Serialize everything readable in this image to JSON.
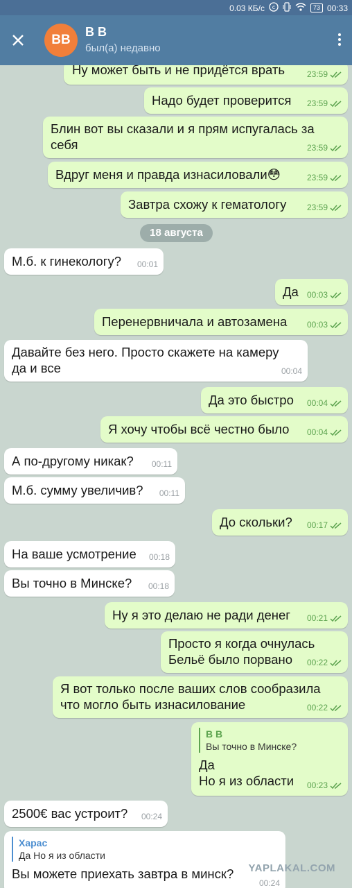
{
  "status_bar": {
    "speed": "0.03 КБ/с",
    "battery": "73",
    "time": "00:33"
  },
  "header": {
    "avatar_initials": "BB",
    "title": "В В",
    "status": "был(а) недавно"
  },
  "date_separator": "18 августа",
  "messages": [
    {
      "text": "Ну может быть и не придётся врать",
      "time": "23:59"
    },
    {
      "text": "Надо будет проверится",
      "time": "23:59"
    },
    {
      "text": "Блин вот вы сказали и я прям испугалась за\nсебя",
      "time": "23:59"
    },
    {
      "text": "Вдруг меня и правда изнасиловали😳",
      "time": "23:59"
    },
    {
      "text": "Завтра схожу к гематологу",
      "time": "23:59"
    },
    {
      "text": "М.б. к гинекологу?",
      "time": "00:01"
    },
    {
      "text": "Да",
      "time": "00:03"
    },
    {
      "text": "Перенервничала и автозамена",
      "time": "00:03"
    },
    {
      "text": "Давайте без него. Просто скажете на камеру\nда и все",
      "time": "00:04"
    },
    {
      "text": "Да это быстро",
      "time": "00:04"
    },
    {
      "text": "Я хочу чтобы всё честно было",
      "time": "00:04"
    },
    {
      "text": "А по-другому никак?",
      "time": "00:11"
    },
    {
      "text": "М.б. сумму увеличив?",
      "time": "00:11"
    },
    {
      "text": "До скольки?",
      "time": "00:17"
    },
    {
      "text": "На ваше усмотрение",
      "time": "00:18"
    },
    {
      "text": "Вы точно в Минске?",
      "time": "00:18"
    },
    {
      "text": "Ну я это делаю не ради денег",
      "time": "00:21"
    },
    {
      "text": "Просто я когда очнулась\nБельё было порвано",
      "time": "00:22"
    },
    {
      "text": "Я вот только после ваших слов сообразила\nчто могло быть изнасилование",
      "time": "00:22"
    },
    {
      "reply_author": "В В",
      "reply_text": "Вы точно в Минске?",
      "text": "Да\nНо я из области",
      "time": "00:23"
    },
    {
      "text": "2500€ вас устроит?",
      "time": "00:24"
    },
    {
      "reply_author": "Харас",
      "reply_text": "Да  Но я из области",
      "text": "Вы можете приехать завтра в минск?",
      "time": "00:24"
    }
  ],
  "watermark": "YAPLAKAL.COM",
  "colors": {
    "header": "#517da2",
    "outgoing": "#e3fcc9",
    "incoming": "#ffffff",
    "background": "#c9d6cf",
    "check": "#5ca34f"
  },
  "icons": {
    "close": "close-icon",
    "menu": "more-vert-icon",
    "read": "double-check-icon"
  }
}
